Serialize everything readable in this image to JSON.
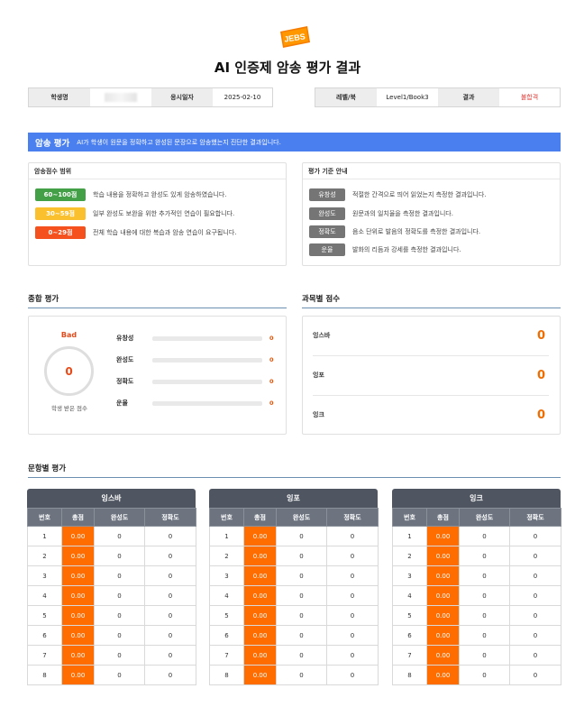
{
  "header": {
    "logo_text": "JEBS",
    "title": "AI 인증제 암송 평가 결과"
  },
  "info": {
    "student_label": "학생명",
    "test_date_label": "응시일자",
    "test_date": "2025-02-10",
    "level_label": "레벨/북",
    "level": "Level1/Book3",
    "result_label": "결과",
    "result": "불합격"
  },
  "banner": {
    "label": "암송 평가",
    "text": "AI가 학생이 원문을 정확하고 완성된 문장으로 암송했는지 진단한 결과입니다."
  },
  "score_range": {
    "title": "암송점수 범위",
    "items": [
      {
        "range": "60~100점",
        "desc": "학습 내용을 정확하고 완성도 있게 암송하였습니다."
      },
      {
        "range": "30~59점",
        "desc": "일부 완성도 보완을 위한 추가적인 연습이 필요합니다."
      },
      {
        "range": "0~29점",
        "desc": "전체 학습 내용에 대한 복습과 암송 연습이 요구됩니다."
      }
    ]
  },
  "criteria": {
    "title": "평가 기준 안내",
    "items": [
      {
        "name": "유창성",
        "desc": "적절한 간격으로 띄어 읽었는지 측정한 결과입니다."
      },
      {
        "name": "완성도",
        "desc": "원문과의 일치율을 측정한 결과입니다."
      },
      {
        "name": "정확도",
        "desc": "음소 단위로 발음의 정확도를 측정한 결과입니다."
      },
      {
        "name": "운율",
        "desc": "발화의 리듬과 강세를 측정한 결과입니다."
      }
    ]
  },
  "overall": {
    "title": "종합 평가",
    "grade": "Bad",
    "score": "0",
    "caption": "학생 받은 점수",
    "metrics": [
      {
        "name": "유창성",
        "value": "0",
        "fill": 0
      },
      {
        "name": "완성도",
        "value": "0",
        "fill": 0
      },
      {
        "name": "정확도",
        "value": "0",
        "fill": 0
      },
      {
        "name": "운율",
        "value": "0",
        "fill": 0
      }
    ]
  },
  "subjects": {
    "title": "과목별 점수",
    "items": [
      {
        "name": "잉스바",
        "score": "0"
      },
      {
        "name": "잉포",
        "score": "0"
      },
      {
        "name": "잉크",
        "score": "0"
      }
    ]
  },
  "sentence_eval": {
    "title": "문항별 평가",
    "columns": [
      "번호",
      "총점",
      "완성도",
      "정확도"
    ],
    "tables": [
      {
        "name": "잉스바",
        "rows": [
          [
            "1",
            "0.00",
            "0",
            "0"
          ],
          [
            "2",
            "0.00",
            "0",
            "0"
          ],
          [
            "3",
            "0.00",
            "0",
            "0"
          ],
          [
            "4",
            "0.00",
            "0",
            "0"
          ],
          [
            "5",
            "0.00",
            "0",
            "0"
          ],
          [
            "6",
            "0.00",
            "0",
            "0"
          ],
          [
            "7",
            "0.00",
            "0",
            "0"
          ],
          [
            "8",
            "0.00",
            "0",
            "0"
          ]
        ]
      },
      {
        "name": "잉포",
        "rows": [
          [
            "1",
            "0.00",
            "0",
            "0"
          ],
          [
            "2",
            "0.00",
            "0",
            "0"
          ],
          [
            "3",
            "0.00",
            "0",
            "0"
          ],
          [
            "4",
            "0.00",
            "0",
            "0"
          ],
          [
            "5",
            "0.00",
            "0",
            "0"
          ],
          [
            "6",
            "0.00",
            "0",
            "0"
          ],
          [
            "7",
            "0.00",
            "0",
            "0"
          ],
          [
            "8",
            "0.00",
            "0",
            "0"
          ]
        ]
      },
      {
        "name": "잉크",
        "rows": [
          [
            "1",
            "0.00",
            "0",
            "0"
          ],
          [
            "2",
            "0.00",
            "0",
            "0"
          ],
          [
            "3",
            "0.00",
            "0",
            "0"
          ],
          [
            "4",
            "0.00",
            "0",
            "0"
          ],
          [
            "5",
            "0.00",
            "0",
            "0"
          ],
          [
            "6",
            "0.00",
            "0",
            "0"
          ],
          [
            "7",
            "0.00",
            "0",
            "0"
          ],
          [
            "8",
            "0.00",
            "0",
            "0"
          ]
        ]
      }
    ]
  },
  "colors": {
    "accent": "#4a7ff0",
    "orange": "#ff6d00",
    "fail": "#e53935",
    "header_dark": "#4f5561"
  }
}
